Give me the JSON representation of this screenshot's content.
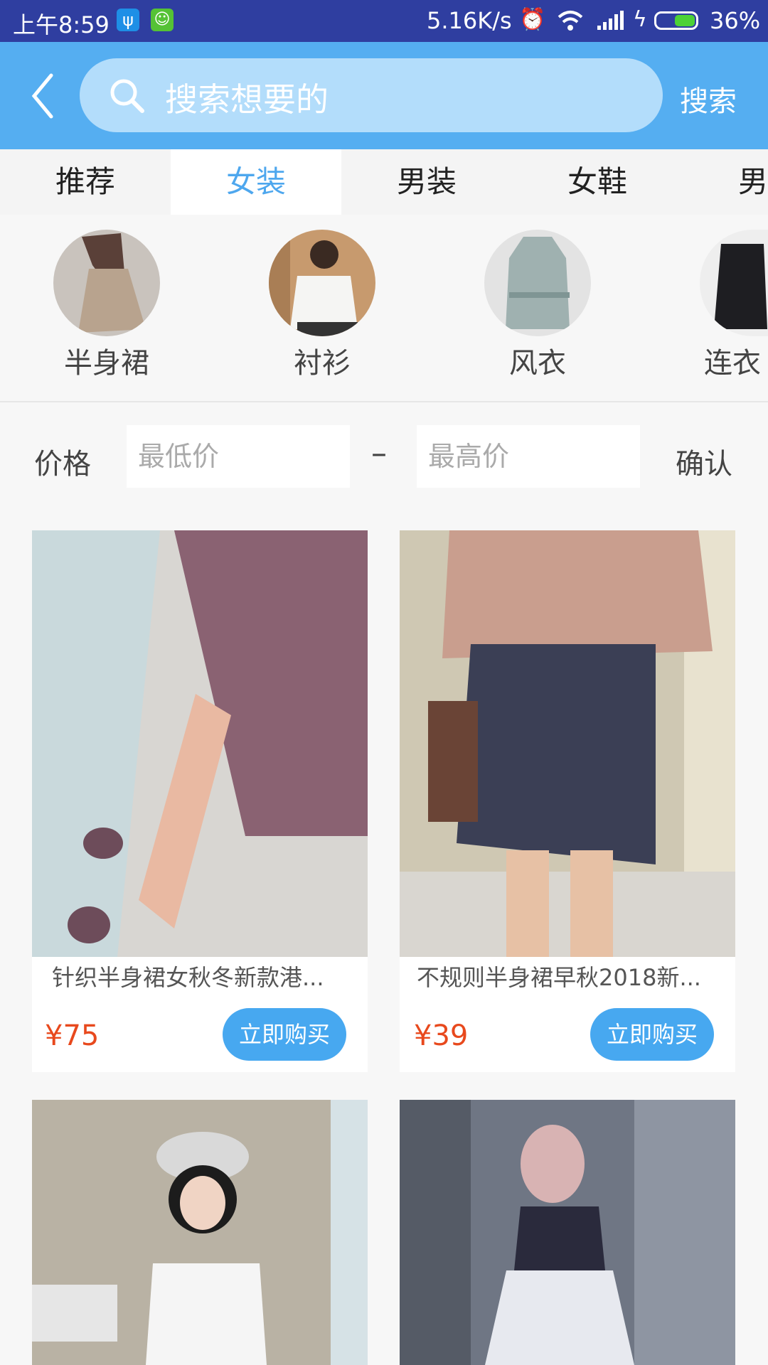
{
  "status_bar": {
    "time": "上午8:59",
    "net_speed": "5.16K/s",
    "battery": "36%",
    "usb_icon": "ψ",
    "app_icon": "☺"
  },
  "search": {
    "placeholder": "搜索想要的",
    "button_label": "搜索"
  },
  "tabs": [
    {
      "label": "推荐"
    },
    {
      "label": "女装"
    },
    {
      "label": "男装"
    },
    {
      "label": "女鞋"
    },
    {
      "label": "男"
    }
  ],
  "subcategories": [
    {
      "label": "半身裙"
    },
    {
      "label": "衬衫"
    },
    {
      "label": "风衣"
    },
    {
      "label": "连衣"
    }
  ],
  "price_filter": {
    "label": "价格",
    "min_placeholder": "最低价",
    "separator": "–",
    "max_placeholder": "最高价",
    "confirm_label": "确认"
  },
  "products": [
    {
      "title": "针织半身裙女秋冬新款港...",
      "price": "¥75",
      "buy_label": "立即购买"
    },
    {
      "title": "不规则半身裙早秋2018新...",
      "price": "¥39",
      "buy_label": "立即购买"
    }
  ],
  "colors": {
    "header": "#55aef1",
    "accent": "#4ea7ee",
    "price": "#e8491d",
    "status_bar": "#2f3ea0"
  }
}
